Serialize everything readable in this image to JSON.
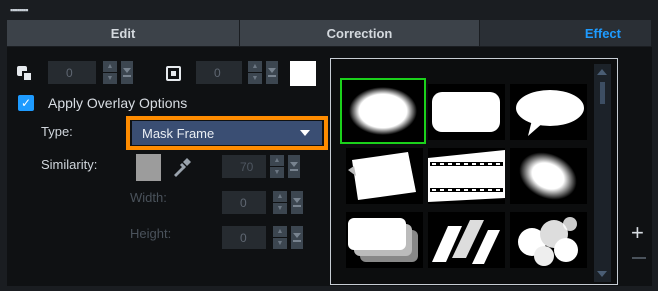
{
  "tabs": [
    {
      "label": "Edit",
      "active": false
    },
    {
      "label": "Correction",
      "active": false
    },
    {
      "label": "Effect",
      "active": true
    }
  ],
  "row1": {
    "copy_value": "0",
    "frame_value": "0",
    "color_swatch": "#ffffff"
  },
  "overlay": {
    "apply_label": "Apply Overlay Options",
    "checked": true
  },
  "type": {
    "label": "Type:",
    "selected": "Mask Frame"
  },
  "similarity": {
    "label": "Similarity:",
    "swatch_color": "#9c9c9c",
    "value": "70"
  },
  "width": {
    "label": "Width:",
    "value": "0"
  },
  "height": {
    "label": "Height:",
    "value": "0"
  },
  "mask_thumbs": [
    {
      "name": "oval-mask",
      "selected": true
    },
    {
      "name": "rounded-rect-mask",
      "selected": false
    },
    {
      "name": "speech-bubble-mask",
      "selected": false
    },
    {
      "name": "paper-mask",
      "selected": false
    },
    {
      "name": "film-strip-mask",
      "selected": false
    },
    {
      "name": "soft-oval-mask",
      "selected": false
    },
    {
      "name": "stacked-frames-mask",
      "selected": false
    },
    {
      "name": "slanted-bars-mask",
      "selected": false
    },
    {
      "name": "bubbles-mask",
      "selected": false
    }
  ],
  "icons": {
    "add": "+",
    "remove": "−",
    "check": "✓"
  },
  "colors": {
    "accent": "#1e9bff",
    "highlight": "#ff8c00",
    "selected_thumb": "#1bd11b"
  }
}
